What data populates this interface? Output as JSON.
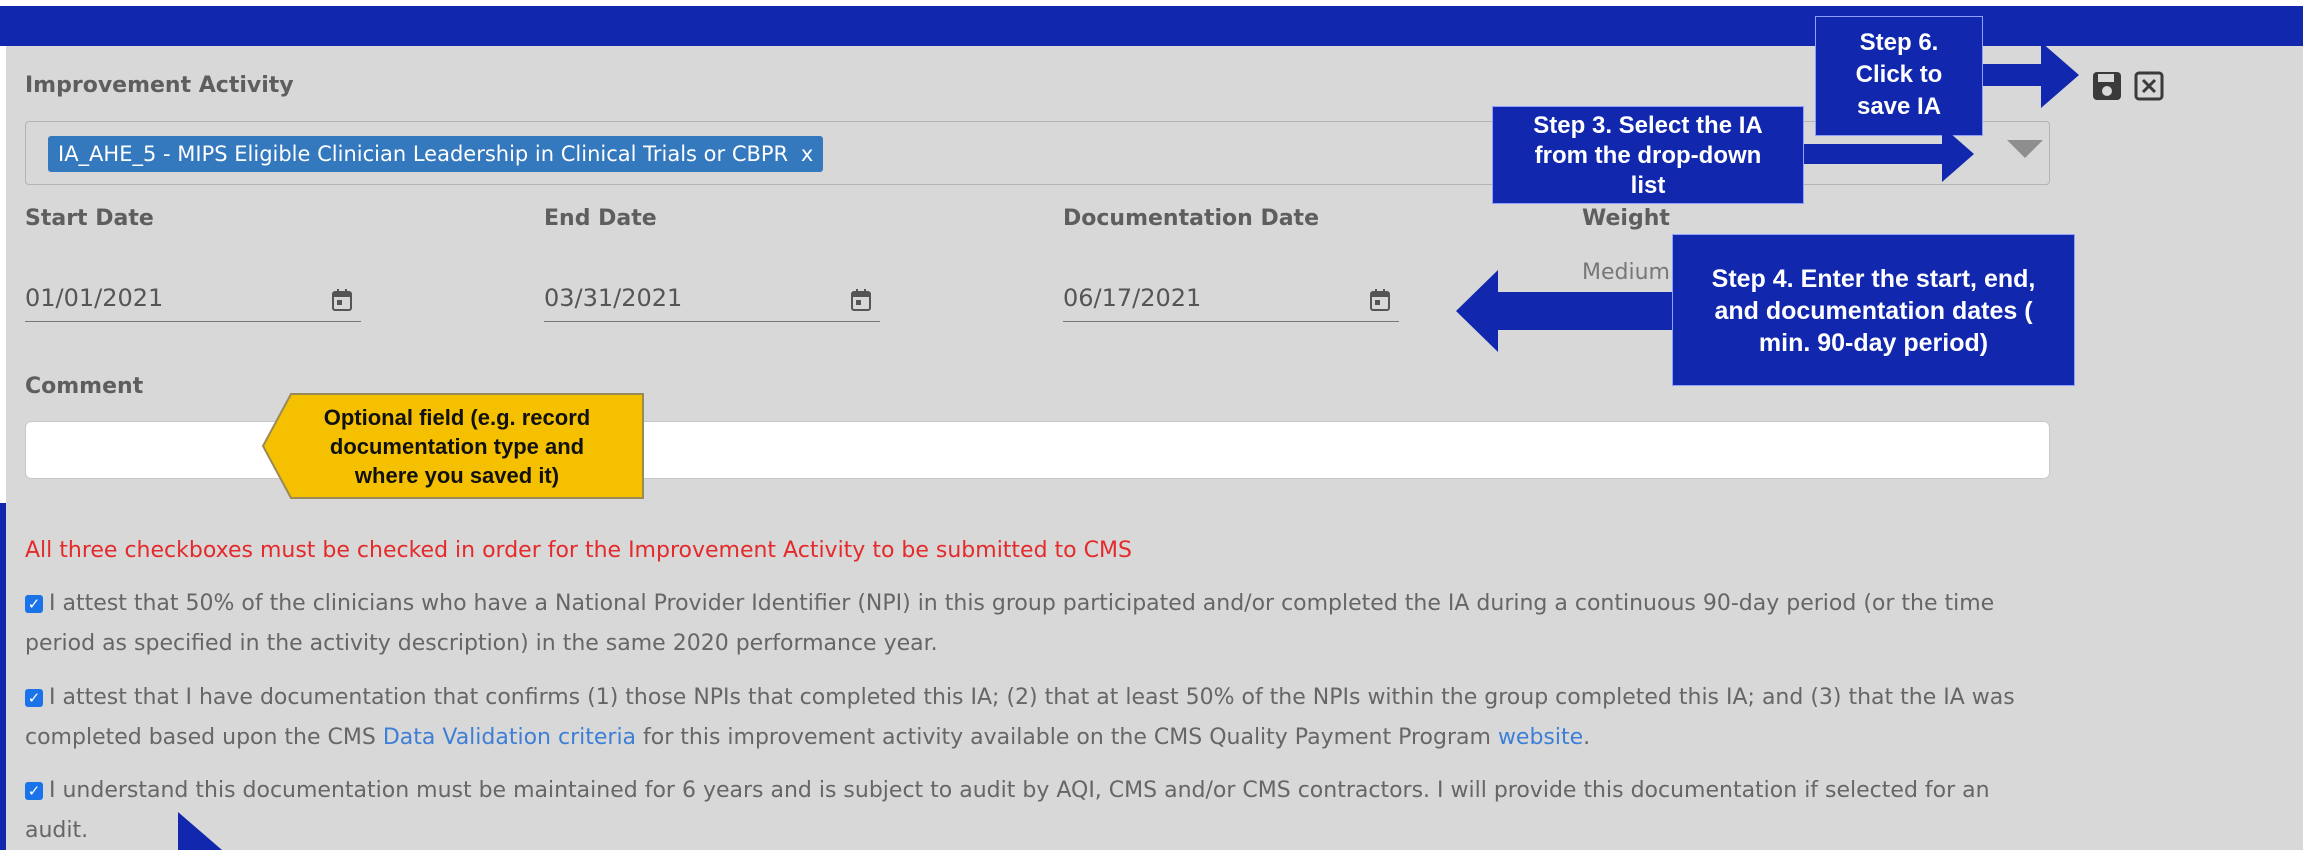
{
  "form": {
    "activity_label": "Improvement Activity",
    "selected_activity": "IA_AHE_5 - MIPS Eligible Clinician Leadership in Clinical Trials or CBPR",
    "tag_remove": "x",
    "start_label": "Start Date",
    "start_value": "01/01/2021",
    "end_label": "End Date",
    "end_value": "03/31/2021",
    "doc_label": "Documentation Date",
    "doc_value": "06/17/2021",
    "weight_label": "Weight",
    "weight_value": "Medium",
    "comment_label": "Comment",
    "comment_value": "",
    "warning": "All three checkboxes must be checked in order for the Improvement Activity to be submitted to CMS",
    "attest1": "I attest that 50% of the clinicians who have a National Provider Identifier (NPI) in this group participated and/or completed the IA during a continuous 90-day period (or the time period as specified in the activity description) in the same 2020 performance year.",
    "attest2_pre": "I attest that I have documentation that confirms (1) those NPIs that completed this IA; (2) that at least 50% of the NPIs within the group completed this IA; and (3) that the IA was completed based upon the CMS ",
    "attest2_link1": "Data Validation criteria",
    "attest2_mid": " for this improvement activity available on the CMS Quality Payment Program ",
    "attest2_link2": "website",
    "attest2_post": ".",
    "attest3": "I understand this documentation must be maintained for 6 years and is subject to audit by AQI, CMS and/or CMS contractors. I will provide this documentation if selected for an audit.",
    "checkboxes": [
      true,
      true,
      true
    ],
    "icons": [
      "save-icon",
      "close-icon",
      "calendar-icon"
    ]
  },
  "callouts": {
    "step6_l1": "Step 6.",
    "step6_l2": "Click to",
    "step6_l3": "save IA",
    "step3_l1": "Step 3. Select the IA",
    "step3_l2": "from the drop-down",
    "step3_l3": "list",
    "step4_l1": "Step 4. Enter the start, end,",
    "step4_l2": "and documentation dates (",
    "step4_l3": "min. 90-day period)",
    "optional_l1": "Optional field (e.g. record",
    "optional_l2": "documentation type and",
    "optional_l3": "where you saved it)"
  },
  "colors": {
    "header": "#1127ad",
    "callout": "#1127ad",
    "tag": "#3478bd",
    "warning": "#e42a2a",
    "link": "#3d7fd6",
    "optional_callout": "#f5c000"
  }
}
